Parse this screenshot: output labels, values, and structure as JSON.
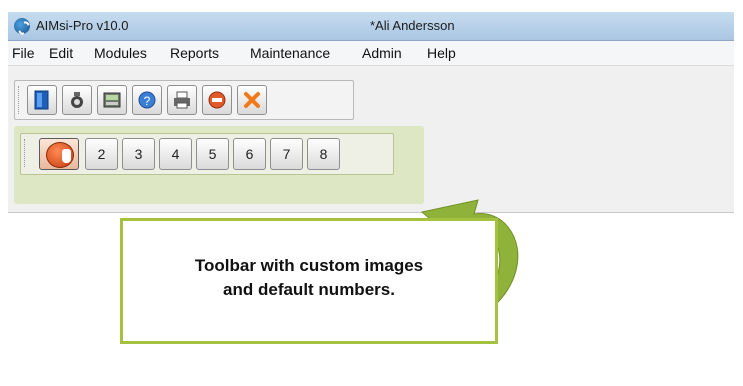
{
  "window": {
    "app_title": "AIMsi-Pro v10.0",
    "document_title": "*Ali Andersson"
  },
  "menu": [
    "File",
    "Edit",
    "Modules",
    "Reports",
    "Maintenance",
    "Admin",
    "Help"
  ],
  "toolbar_main": {
    "buttons": [
      "new-document-icon",
      "camera-icon",
      "register-icon",
      "help-icon",
      "printer-icon",
      "minus-circle-icon",
      "close-x-icon"
    ]
  },
  "toolbar_numbers": {
    "first_button_icon": "stop-hand-icon",
    "labels": [
      "2",
      "3",
      "4",
      "5",
      "6",
      "7",
      "8"
    ]
  },
  "callout": {
    "line1": "Toolbar with custom images",
    "line2": "and default numbers."
  },
  "colors": {
    "callout_border": "#a4c23f",
    "highlight": "#cfe0a0",
    "arrow": "#8fb33a"
  }
}
